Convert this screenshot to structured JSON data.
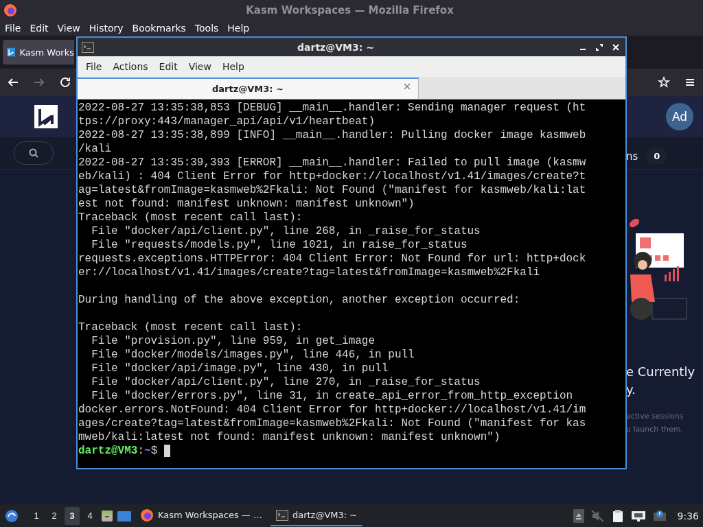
{
  "firefox": {
    "title": "Kasm Workspaces — Mozilla Firefox",
    "menu": [
      "File",
      "Edit",
      "View",
      "History",
      "Bookmarks",
      "Tools",
      "Help"
    ],
    "tab": {
      "label": "Kasm Works",
      "selected": true
    },
    "nav": {
      "forward_disabled": true
    }
  },
  "kasm": {
    "avatar": "Ad",
    "sessions_label": "ns",
    "sessions_count": "0",
    "empty_title": [
      "e Currently",
      "y."
    ],
    "empty_text": [
      "active sessions",
      "u launch them."
    ]
  },
  "terminal": {
    "title": "dartz@VM3: ~",
    "menu": [
      "File",
      "Actions",
      "Edit",
      "View",
      "Help"
    ],
    "tabs": [
      {
        "label": "dartz@VM3: ~",
        "selected": true
      }
    ],
    "blocks": [
      [
        "2022-08-27 13:35:38,853 [DEBUG] __main__.handler: Sending manager request (ht",
        "tps://proxy:443/manager_api/api/v1/heartbeat)",
        "2022-08-27 13:35:38,899 [INFO] __main__.handler: Pulling docker image kasmweb",
        "/kali",
        "2022-08-27 13:35:39,393 [ERROR] __main__.handler: Failed to pull image (kasmw",
        "eb/kali) : 404 Client Error for http+docker://localhost/v1.41/images/create?t",
        "ag=latest&fromImage=kasmweb%2Fkali: Not Found (\"manifest for kasmweb/kali:lat",
        "est not found: manifest unknown: manifest unknown\")",
        "Traceback (most recent call last):",
        "  File \"docker/api/client.py\", line 268, in _raise_for_status",
        "  File \"requests/models.py\", line 1021, in raise_for_status",
        "requests.exceptions.HTTPError: 404 Client Error: Not Found for url: http+dock",
        "er://localhost/v1.41/images/create?tag=latest&fromImage=kasmweb%2Fkali"
      ],
      [
        "During handling of the above exception, another exception occurred:"
      ],
      [
        "Traceback (most recent call last):",
        "  File \"provision.py\", line 959, in get_image",
        "  File \"docker/models/images.py\", line 446, in pull",
        "  File \"docker/api/image.py\", line 430, in pull",
        "  File \"docker/api/client.py\", line 270, in _raise_for_status",
        "  File \"docker/errors.py\", line 31, in create_api_error_from_http_exception",
        "docker.errors.NotFound: 404 Client Error for http+docker://localhost/v1.41/im",
        "ages/create?tag=latest&fromImage=kasmweb%2Fkali: Not Found (\"manifest for kas",
        "mweb/kali:latest not found: manifest unknown: manifest unknown\")"
      ]
    ],
    "prompt": {
      "user_host": "dartz@VM3",
      "separator": ":",
      "path": "~",
      "symbol": "$"
    }
  },
  "taskbar": {
    "workspaces": [
      {
        "label": "1",
        "selected": false
      },
      {
        "label": "2",
        "selected": false
      },
      {
        "label": "3",
        "selected": true
      },
      {
        "label": "4",
        "selected": false
      }
    ],
    "tasks": [
      {
        "kind": "browser",
        "label": "Kasm Workspaces — …",
        "selected": false
      },
      {
        "kind": "terminal",
        "label": "dartz@VM3: ~",
        "selected": true
      }
    ],
    "clock": "9:36"
  }
}
